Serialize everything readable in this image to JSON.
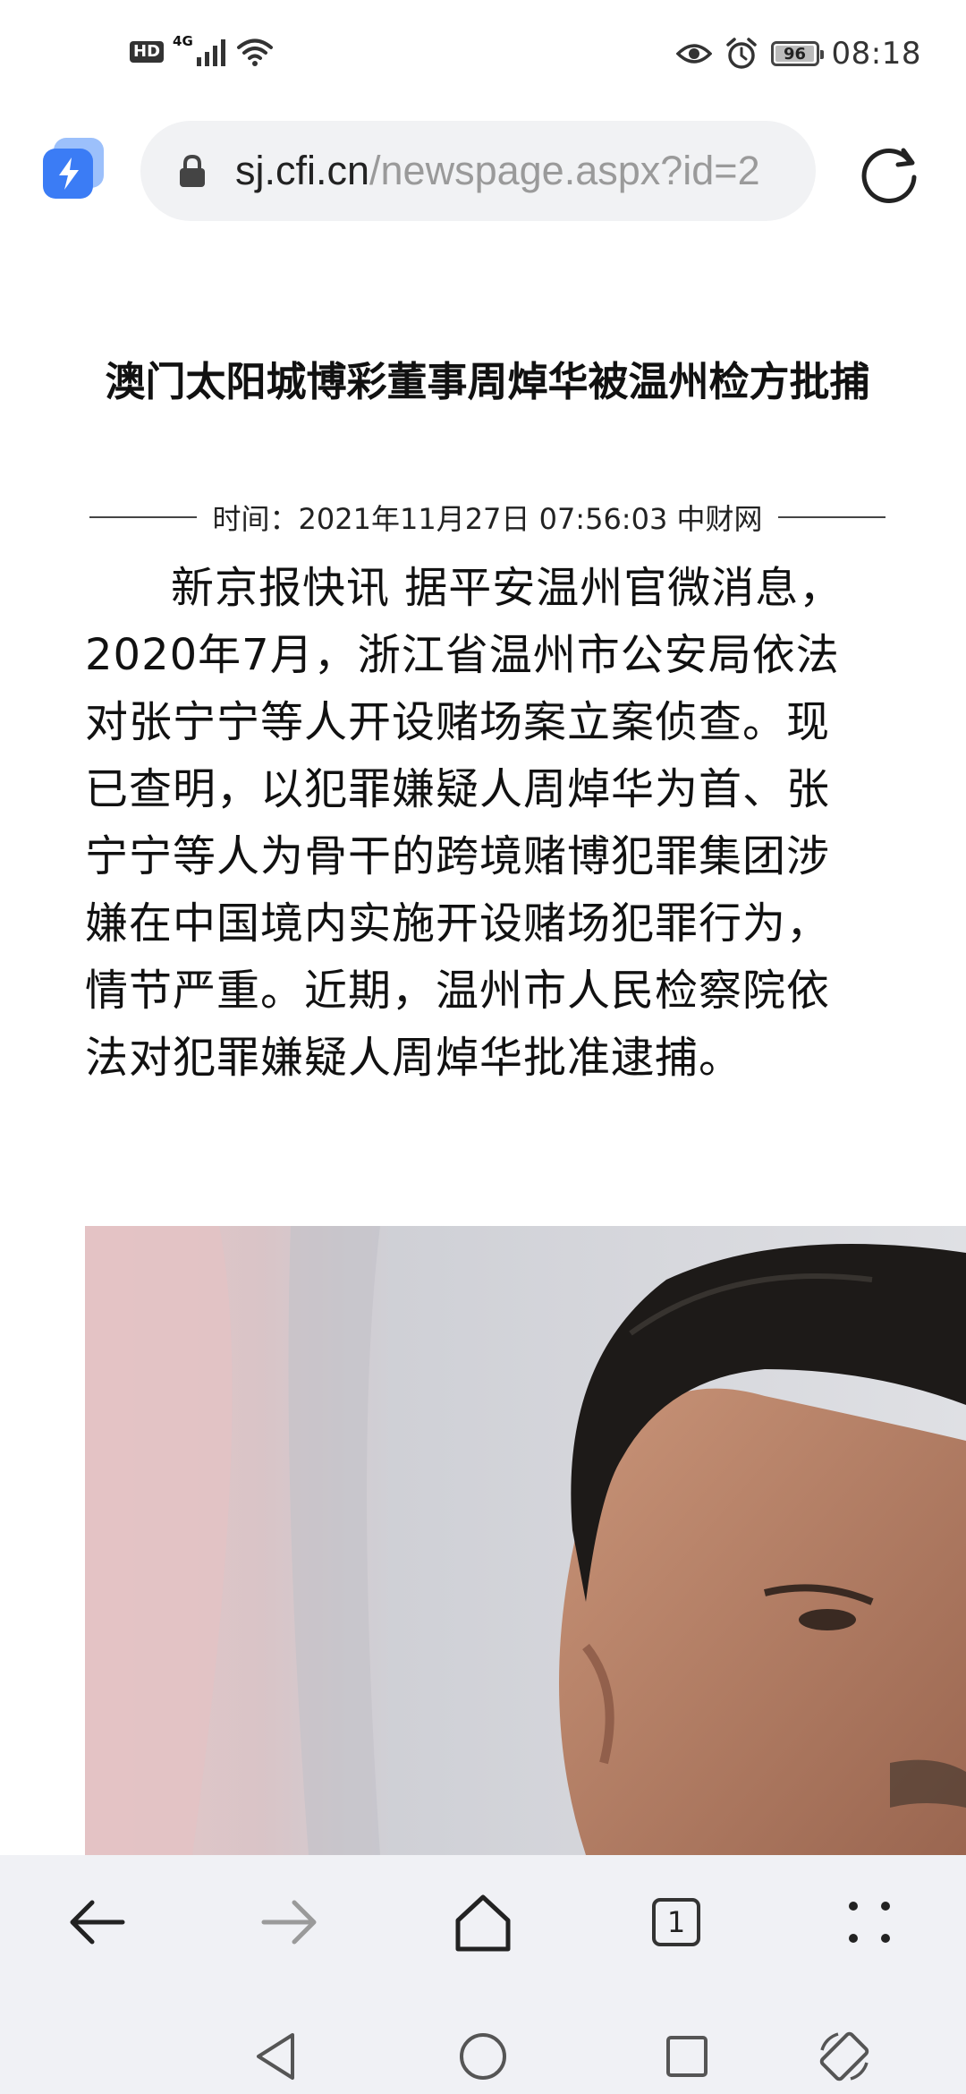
{
  "status_bar": {
    "hd_label": "HD",
    "network_label": "4G",
    "battery_level": "96",
    "time": "08:18"
  },
  "browser": {
    "url_domain": "sj.cfi.cn",
    "url_path": "/newspage.aspx?id=2"
  },
  "article": {
    "title": "澳门太阳城博彩董事周焯华被温州检方批捕",
    "meta": "时间：2021年11月27日 07:56:03 中财网",
    "body": "新京报快讯 据平安温州官微消息，2020年7月，浙江省温州市公安局依法对张宁宁等人开设赌场案立案侦查。现已查明，以犯罪嫌疑人周焯华为首、张宁宁等人为骨干的跨境赌博犯罪集团涉嫌在中国境内实施开设赌场犯罪行为，情节严重。近期，温州市人民检察院依法对犯罪嫌疑人周焯华批准逮捕。"
  },
  "bottom_nav": {
    "tab_count": "1"
  },
  "colors": {
    "accent_blue": "#3b7cf5",
    "nav_bg": "#f0f1f5",
    "url_bar_bg": "#f1f2f4"
  }
}
